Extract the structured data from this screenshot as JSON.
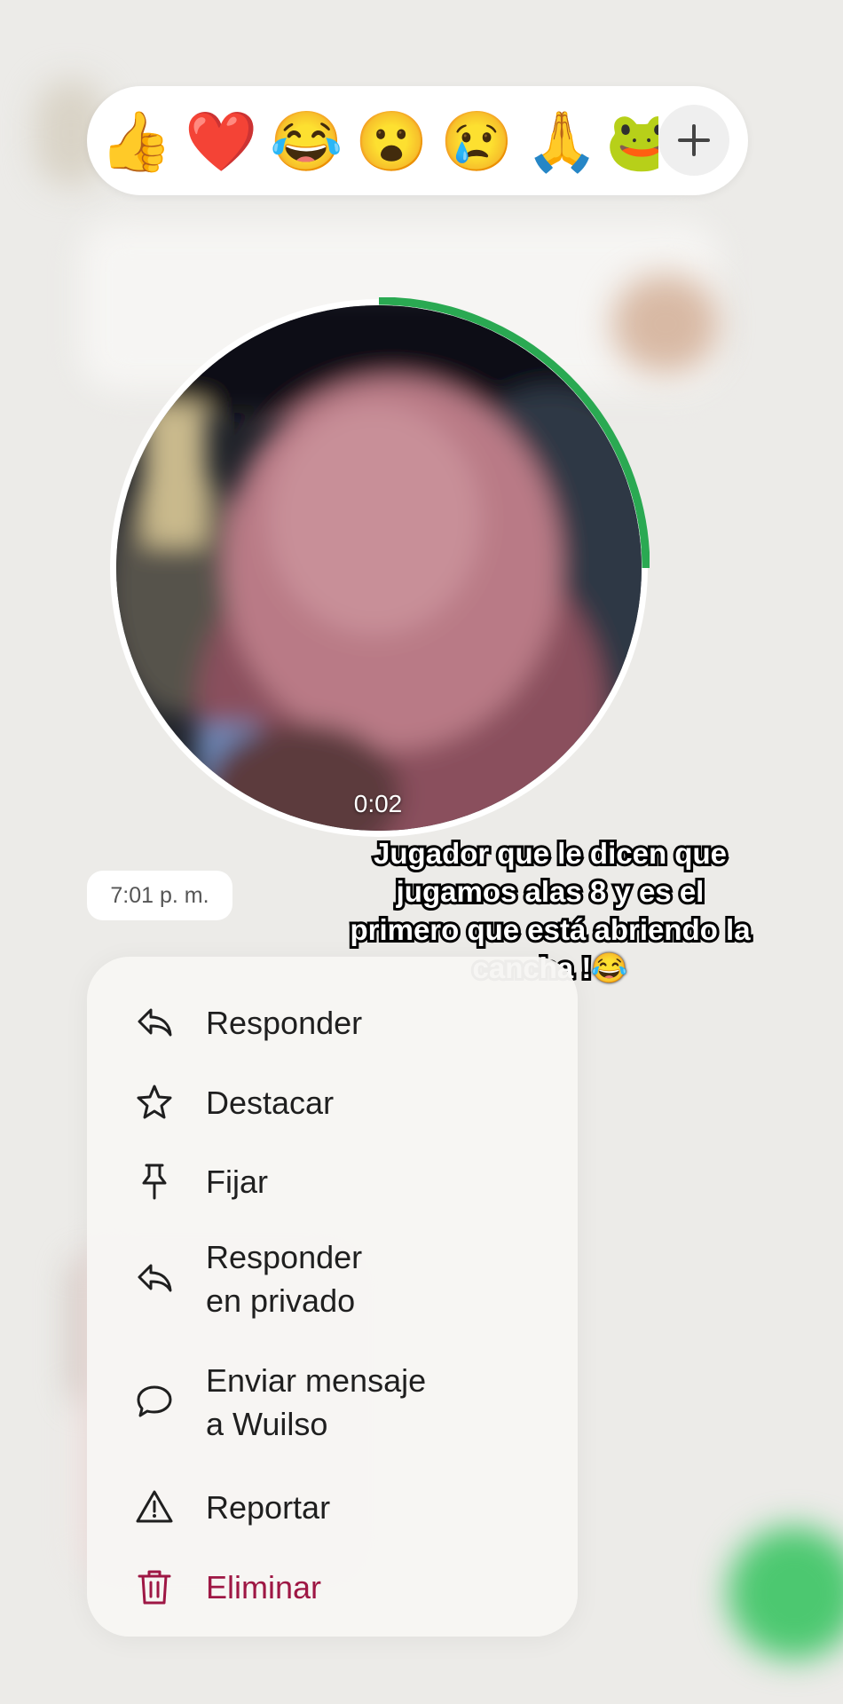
{
  "reactions": {
    "emojis": [
      {
        "glyph": "👍",
        "name": "thumbs-up"
      },
      {
        "glyph": "❤️",
        "name": "red-heart"
      },
      {
        "glyph": "😂",
        "name": "tears-of-joy"
      },
      {
        "glyph": "😮",
        "name": "surprised"
      },
      {
        "glyph": "😢",
        "name": "crying"
      },
      {
        "glyph": "🙏",
        "name": "folded-hands"
      },
      {
        "glyph": "🐸",
        "name": "frog"
      }
    ],
    "more_icon": "plus-icon"
  },
  "video": {
    "duration": "0:02",
    "progress_fraction": 0.25,
    "progress_color": "#2aa952"
  },
  "message": {
    "timestamp": "7:01 p. m.",
    "caption": "Jugador que le dicen que\njugamos alas 8 y es el\nprimero que está abriendo la\ncancha !😂"
  },
  "menu": {
    "items": [
      {
        "label": "Responder",
        "icon": "reply-icon"
      },
      {
        "label": "Destacar",
        "icon": "star-icon"
      },
      {
        "label": "Fijar",
        "icon": "pin-icon"
      },
      {
        "label": "Responder\nen privado",
        "icon": "reply-private-icon"
      },
      {
        "label": "Enviar mensaje\na Wuilso",
        "icon": "chat-bubble-icon"
      },
      {
        "label": "Reportar",
        "icon": "warning-icon"
      },
      {
        "label": "Eliminar",
        "icon": "trash-icon",
        "danger": true
      }
    ],
    "danger_color": "#9e1744"
  }
}
